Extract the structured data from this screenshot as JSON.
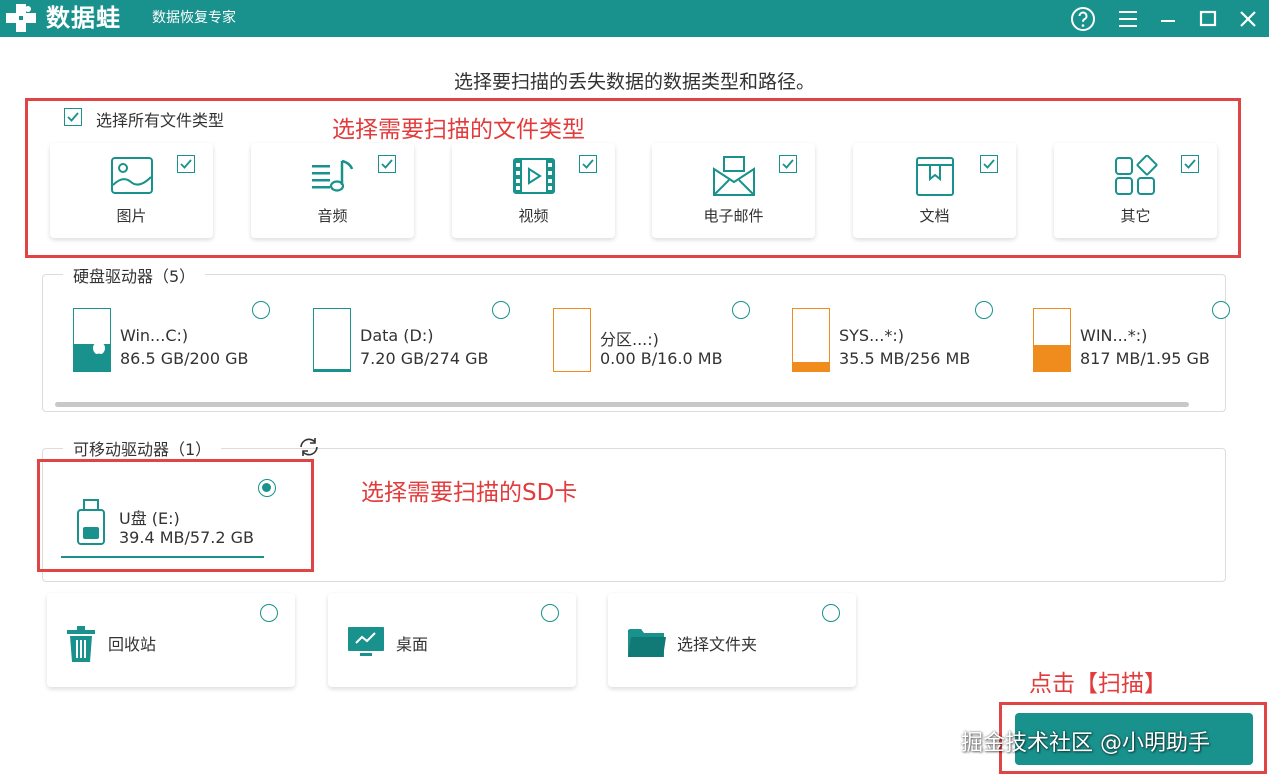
{
  "app": {
    "name": "数据蛙",
    "subtitle": "数据恢复专家"
  },
  "heading": "选择要扫描的丢失数据的数据类型和路径。",
  "select_all_label": "选择所有文件类型",
  "file_types": [
    {
      "label": "图片",
      "icon": "image-icon",
      "checked": true
    },
    {
      "label": "音频",
      "icon": "audio-icon",
      "checked": true
    },
    {
      "label": "视频",
      "icon": "video-icon",
      "checked": true
    },
    {
      "label": "电子邮件",
      "icon": "email-icon",
      "checked": true
    },
    {
      "label": "文档",
      "icon": "document-icon",
      "checked": true
    },
    {
      "label": "其它",
      "icon": "other-icon",
      "checked": true
    }
  ],
  "annotations": {
    "types": "选择需要扫描的文件类型",
    "sd": "选择需要扫描的SD卡",
    "scan": "点击【扫描】"
  },
  "hard_drives": {
    "title": "硬盘驱动器（5）",
    "items": [
      {
        "name": "Win...C:)",
        "size": "86.5 GB/200 GB",
        "fill": 0.43,
        "color": "#19918c",
        "selected": false
      },
      {
        "name": "Data (D:)",
        "size": "7.20 GB/274 GB",
        "fill": 0.03,
        "color": "#19918c",
        "selected": false
      },
      {
        "name": "分区...:)",
        "size": "0.00  B/16.0 MB",
        "fill": 0.0,
        "color": "#f08c1e",
        "selected": false
      },
      {
        "name": "SYS...*:)",
        "size": "35.5 MB/256 MB",
        "fill": 0.14,
        "color": "#f08c1e",
        "selected": false
      },
      {
        "name": "WIN...*:)",
        "size": "817 MB/1.95 GB",
        "fill": 0.42,
        "color": "#f08c1e",
        "selected": false
      }
    ]
  },
  "removable": {
    "title": "可移动驱动器（1）",
    "items": [
      {
        "name": "U盘 (E:)",
        "size": "39.4 MB/57.2 GB",
        "selected": true
      }
    ]
  },
  "locations": [
    {
      "label": "回收站",
      "icon": "trash-icon"
    },
    {
      "label": "桌面",
      "icon": "desktop-icon"
    },
    {
      "label": "选择文件夹",
      "icon": "folder-icon"
    }
  ],
  "watermark": "掘金技术社区 @小明助手",
  "colors": {
    "accent": "#19918c",
    "warning": "#f08c1e",
    "annotation": "#e04445"
  }
}
